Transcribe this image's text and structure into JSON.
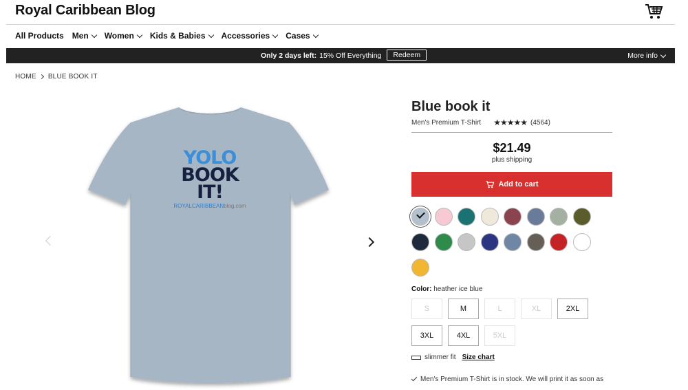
{
  "header": {
    "site_title": "Royal Caribbean Blog",
    "cart_icon": "cart-icon"
  },
  "nav": {
    "items": [
      {
        "label": "All Products",
        "has_menu": false
      },
      {
        "label": "Men",
        "has_menu": true
      },
      {
        "label": "Women",
        "has_menu": true
      },
      {
        "label": "Kids & Babies",
        "has_menu": true
      },
      {
        "label": "Accessories",
        "has_menu": true
      },
      {
        "label": "Cases",
        "has_menu": true
      }
    ]
  },
  "promo": {
    "bold_text": "Only 2 days left:",
    "text": "15% Off Everything",
    "redeem_label": "Redeem",
    "more_info_label": "More info"
  },
  "breadcrumb": {
    "home": "HOME",
    "current": "BLUE BOOK IT"
  },
  "gallery": {
    "design": {
      "line1": "YOLO",
      "line2": "BOOK",
      "line3": "IT!",
      "site_a": "ROYALCARIBBEAN",
      "site_b": "blog.com"
    },
    "shirt_color": "#a7b6c4"
  },
  "product": {
    "title": "Blue book it",
    "type": "Men's Premium T-Shirt",
    "rating_stars": "★★★★★",
    "rating": 4.5,
    "reviews": "(4564)",
    "price": "$21.49",
    "shipping": "plus shipping",
    "add_to_cart": "Add to cart",
    "color_label": "Color:",
    "color_value": "heather ice blue",
    "fit": "slimmer fit",
    "size_chart": "Size chart",
    "stock": "Men's Premium T-Shirt is in stock. We will print it as soon as"
  },
  "swatches": [
    {
      "name": "heather ice blue",
      "color": "#b3c1cf",
      "selected": true
    },
    {
      "name": "pink",
      "color": "#f7c9d2",
      "selected": false
    },
    {
      "name": "teal",
      "color": "#1a7372",
      "selected": false
    },
    {
      "name": "natural",
      "color": "#efe9dc",
      "selected": false
    },
    {
      "name": "burgundy",
      "color": "#8b4350",
      "selected": false
    },
    {
      "name": "denim",
      "color": "#6a7b9a",
      "selected": false
    },
    {
      "name": "sage",
      "color": "#a3b0a2",
      "selected": false
    },
    {
      "name": "olive",
      "color": "#5a5c2c",
      "selected": false
    },
    {
      "name": "navy",
      "color": "#1f2a3c",
      "selected": false
    },
    {
      "name": "kelly green",
      "color": "#2f8b4b",
      "selected": false
    },
    {
      "name": "heather grey",
      "color": "#c6c6c6",
      "selected": false
    },
    {
      "name": "royal blue",
      "color": "#2b3580",
      "selected": false
    },
    {
      "name": "heather blue",
      "color": "#6f86a4",
      "selected": false
    },
    {
      "name": "charcoal",
      "color": "#665f58",
      "selected": false
    },
    {
      "name": "red",
      "color": "#c42425",
      "selected": false
    },
    {
      "name": "white",
      "color": "#ffffff",
      "selected": false
    },
    {
      "name": "gold",
      "color": "#f1b632",
      "selected": false
    }
  ],
  "sizes": [
    {
      "label": "S",
      "available": false
    },
    {
      "label": "M",
      "available": true
    },
    {
      "label": "L",
      "available": false
    },
    {
      "label": "XL",
      "available": false
    },
    {
      "label": "2XL",
      "available": true
    },
    {
      "label": "3XL",
      "available": true
    },
    {
      "label": "4XL",
      "available": true
    },
    {
      "label": "5XL",
      "available": false
    }
  ]
}
